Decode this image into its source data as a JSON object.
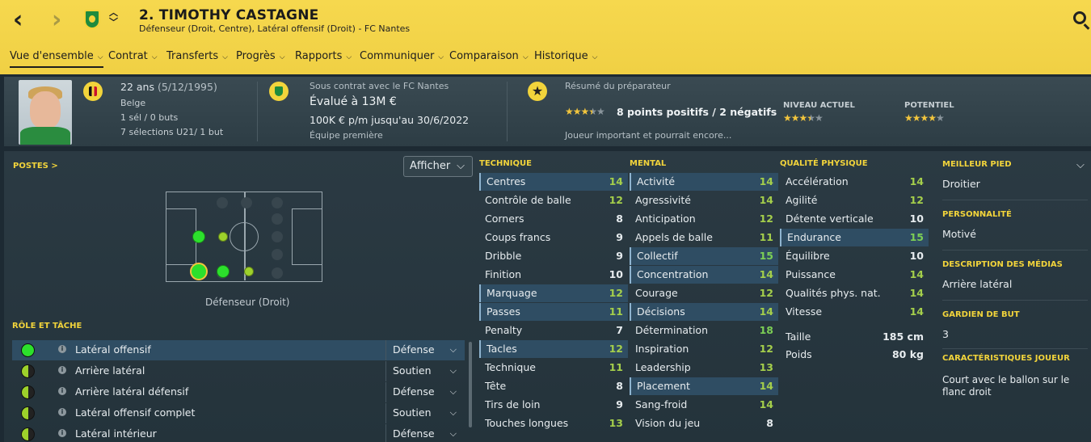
{
  "header": {
    "title": "2. TIMOTHY CASTAGNE",
    "subtitle": "Défenseur (Droit, Centre), Latéral offensif (Droit) - FC Nantes"
  },
  "menu": [
    {
      "label": "Vue d'ensemble",
      "active": true
    },
    {
      "label": "Contrat"
    },
    {
      "label": "Transferts"
    },
    {
      "label": "Progrès"
    },
    {
      "label": "Rapports"
    },
    {
      "label": "Communiquer"
    },
    {
      "label": "Comparaison"
    },
    {
      "label": "Historique"
    }
  ],
  "info": {
    "age": "22 ans",
    "dob": "(5/12/1995)",
    "nationality": "Belge",
    "caps": "1 sél / 0 buts",
    "u21": "7 sélections U21/ 1 but",
    "contract_club": "Sous contrat avec le FC Nantes",
    "value": "Évalué à 13M €",
    "wage": "100K € p/m jusqu'au 30/6/2022",
    "squad": "Équipe première",
    "coach_title": "Résumé du préparateur",
    "coach_summary": "8 points positifs / 2 négatifs",
    "coach_text": "Joueur important et pourrait encore...",
    "coach_stars": 3.5,
    "current_label": "NIVEAU ACTUEL",
    "current_stars": 3.5,
    "potential_label": "POTENTIEL",
    "potential_stars": 4
  },
  "positions": {
    "title": "POSTES >",
    "afficher": "Afficher",
    "pitch_label": "Défenseur (Droit)"
  },
  "roles": {
    "title": "RÔLE ET TÂCHE",
    "items": [
      {
        "name": "Latéral offensif",
        "task": "Défense",
        "level": 1.0
      },
      {
        "name": "Arrière latéral",
        "task": "Soutien",
        "level": 0.5
      },
      {
        "name": "Arrière latéral défensif",
        "task": "Défense",
        "level": 0.5
      },
      {
        "name": "Latéral offensif complet",
        "task": "Soutien",
        "level": 0.5
      },
      {
        "name": "Latéral intérieur",
        "task": "Défense",
        "level": 0.5
      }
    ]
  },
  "technique": {
    "title": "TECHNIQUE",
    "items": [
      {
        "name": "Centres",
        "value": "14"
      },
      {
        "name": "Contrôle de balle",
        "value": "12"
      },
      {
        "name": "Corners",
        "value": "8"
      },
      {
        "name": "Coups francs",
        "value": "9"
      },
      {
        "name": "Dribble",
        "value": "9"
      },
      {
        "name": "Finition",
        "value": "10"
      },
      {
        "name": "Marquage",
        "value": "12"
      },
      {
        "name": "Passes",
        "value": "11"
      },
      {
        "name": "Penalty",
        "value": "7"
      },
      {
        "name": "Tacles",
        "value": "12"
      },
      {
        "name": "Technique",
        "value": "11"
      },
      {
        "name": "Tête",
        "value": "8"
      },
      {
        "name": "Tirs de loin",
        "value": "9"
      },
      {
        "name": "Touches longues",
        "value": "13"
      }
    ]
  },
  "mental": {
    "title": "MENTAL",
    "items": [
      {
        "name": "Activité",
        "value": "14"
      },
      {
        "name": "Agressivité",
        "value": "14"
      },
      {
        "name": "Anticipation",
        "value": "12"
      },
      {
        "name": "Appels de balle",
        "value": "11"
      },
      {
        "name": "Collectif",
        "value": "15"
      },
      {
        "name": "Concentration",
        "value": "14"
      },
      {
        "name": "Courage",
        "value": "12"
      },
      {
        "name": "Décisions",
        "value": "14"
      },
      {
        "name": "Détermination",
        "value": "18"
      },
      {
        "name": "Inspiration",
        "value": "12"
      },
      {
        "name": "Leadership",
        "value": "13"
      },
      {
        "name": "Placement",
        "value": "14"
      },
      {
        "name": "Sang-froid",
        "value": "14"
      },
      {
        "name": "Vision du jeu",
        "value": "8"
      }
    ]
  },
  "physical": {
    "title": "QUALITÉ PHYSIQUE",
    "items": [
      {
        "name": "Accélération",
        "value": "14"
      },
      {
        "name": "Agilité",
        "value": "12"
      },
      {
        "name": "Détente verticale",
        "value": "10"
      },
      {
        "name": "Endurance",
        "value": "15"
      },
      {
        "name": "Équilibre",
        "value": "10"
      },
      {
        "name": "Puissance",
        "value": "14"
      },
      {
        "name": "Qualités phys. nat.",
        "value": "14"
      },
      {
        "name": "Vitesse",
        "value": "14"
      }
    ],
    "height_label": "Taille",
    "height": "185 cm",
    "weight_label": "Poids",
    "weight": "80 kg"
  },
  "sidebar": {
    "best_foot_title": "MEILLEUR PIED",
    "best_foot": "Droitier",
    "personality_title": "PERSONNALITÉ",
    "personality": "Motivé",
    "media_title": "DESCRIPTION DES MÉDIAS",
    "media": "Arrière latéral",
    "gk_title": "GARDIEN DE BUT",
    "gk": "3",
    "traits_title": "CARACTÉRISTIQUES JOUEUR",
    "traits": "Court avec le ballon sur le flanc droit"
  },
  "colors": {
    "accent": "#f2d43b",
    "green": "#2ce02c",
    "highlight": "#2f4d63"
  }
}
